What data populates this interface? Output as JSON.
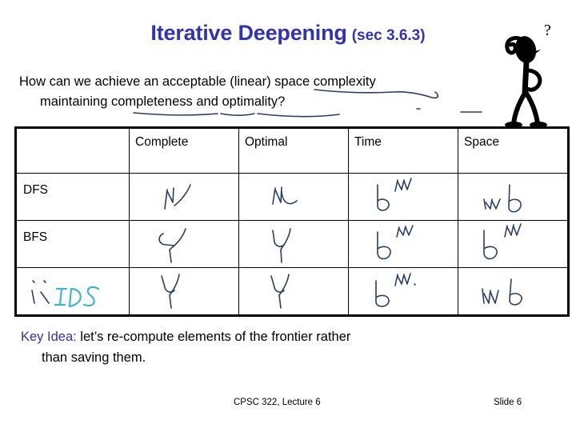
{
  "slide": {
    "title_main": "Iterative Deepening",
    "title_section": "(sec 3.6.3)",
    "title_color": "#3333aa"
  },
  "question": {
    "line_1": "How can we achieve an acceptable (linear) space complexity",
    "line_2": "maintaining completeness and optimality?"
  },
  "table": {
    "headers": [
      "",
      "Complete",
      "Optimal",
      "Time",
      "Space"
    ],
    "rows": [
      {
        "label": "DFS",
        "label_ink": "",
        "cells": [
          {
            "ink": "N",
            "kind": "letter-n"
          },
          {
            "ink": "N",
            "kind": "letter-n"
          },
          {
            "ink": "b^m",
            "kind": "b-exp-m"
          },
          {
            "ink": "mb",
            "kind": "m-b"
          }
        ]
      },
      {
        "label": "BFS",
        "label_ink": "",
        "cells": [
          {
            "ink": "Y",
            "kind": "letter-y"
          },
          {
            "ink": "Y",
            "kind": "letter-y"
          },
          {
            "ink": "b^m",
            "kind": "b-exp-m"
          },
          {
            "ink": "b^m",
            "kind": "b-exp-m"
          }
        ]
      },
      {
        "label": "",
        "label_ink": "IDS",
        "cells": [
          {
            "ink": "Y",
            "kind": "letter-y"
          },
          {
            "ink": "Y",
            "kind": "letter-y"
          },
          {
            "ink": "b^m",
            "kind": "b-exp-m"
          },
          {
            "ink": "mb",
            "kind": "m-b"
          }
        ]
      }
    ],
    "ink_color": "#2b3c66",
    "ids_ink_color": "#3fb3cf"
  },
  "key_idea": {
    "label": "Key Idea:",
    "line_1": " let’s re-compute elements of the frontier rather",
    "line_2": "than saving them.",
    "label_color": "#333399"
  },
  "footer": {
    "left": "CPSC 322, Lecture 6",
    "right": "Slide 6"
  },
  "clipart": {
    "name": "thinking-stick-figure",
    "question_mark": "?"
  }
}
